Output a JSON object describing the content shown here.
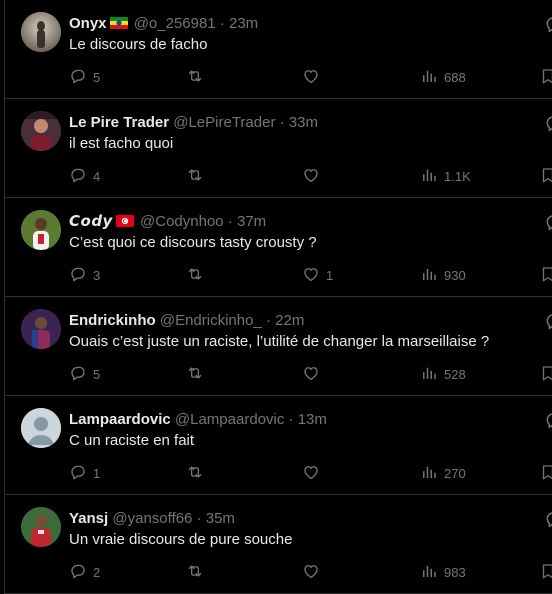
{
  "posts": [
    {
      "name": "Onyx",
      "flag": "ethiopia",
      "handle": "@o_256981",
      "time": "23m",
      "text": "Le discours de facho",
      "replies": "5",
      "retweets": "",
      "likes": "",
      "views": "688",
      "avatar_color": "#a59a8c"
    },
    {
      "name": "Le Pire Trader",
      "flag": "",
      "handle": "@LePireTrader",
      "time": "33m",
      "text": "il est facho quoi",
      "replies": "4",
      "retweets": "",
      "likes": "",
      "views": "1.1K",
      "avatar_color": "#5a3b45"
    },
    {
      "name": "𝘾𝙤𝙙𝙮",
      "flag": "tunisia",
      "handle": "@Codynhoo",
      "time": "37m",
      "text": "C’est quoi ce discours tasty crousty ?",
      "replies": "3",
      "retweets": "",
      "likes": "1",
      "views": "930",
      "avatar_color": "#4f6a2e"
    },
    {
      "name": "Endrickinho",
      "flag": "",
      "handle": "@Endrickinho_",
      "time": "22m",
      "text": "Ouais c’est juste un raciste, l’utilité de changer la marseillaise ?",
      "replies": "5",
      "retweets": "",
      "likes": "",
      "views": "528",
      "avatar_color": "#6a3a7a"
    },
    {
      "name": "Lampaardovic",
      "flag": "",
      "handle": "@Lampaardovic",
      "time": "13m",
      "text": "C un raciste en fait",
      "replies": "1",
      "retweets": "",
      "likes": "",
      "views": "270",
      "avatar_color": "#ccd6dd"
    },
    {
      "name": "Yansj",
      "flag": "",
      "handle": "@yansoff66",
      "time": "35m",
      "text": "Un vraie discours de pure souche",
      "replies": "2",
      "retweets": "",
      "likes": "",
      "views": "983",
      "avatar_color": "#8a2a2a"
    }
  ],
  "icons": {
    "reply": "reply-icon",
    "retweet": "retweet-icon",
    "like": "like-icon",
    "views": "views-icon",
    "bookmark": "bookmark-icon",
    "more": "more-icon"
  },
  "colors": {
    "background": "#000000",
    "text": "#e7e9ea",
    "muted": "#71767b",
    "divider": "#2f3336"
  }
}
